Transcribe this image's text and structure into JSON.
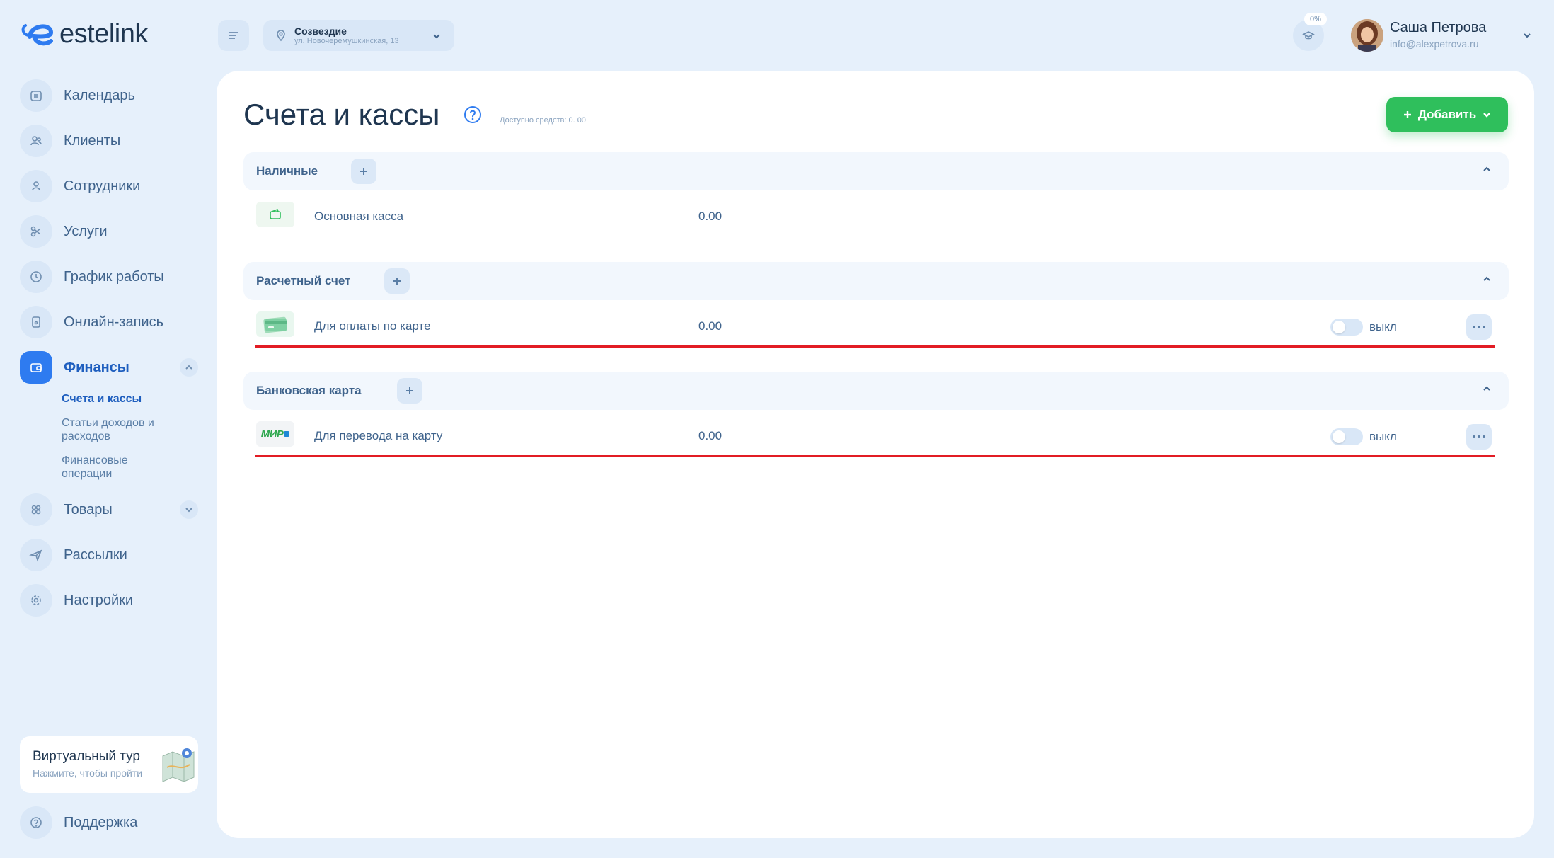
{
  "brand": {
    "name": "estelink"
  },
  "sidebar": {
    "items": [
      {
        "id": "calendar",
        "label": "Календарь",
        "icon": "calendar-icon"
      },
      {
        "id": "clients",
        "label": "Клиенты",
        "icon": "clients-icon"
      },
      {
        "id": "staff",
        "label": "Сотрудники",
        "icon": "user-icon"
      },
      {
        "id": "services",
        "label": "Услуги",
        "icon": "scissors-icon"
      },
      {
        "id": "schedule",
        "label": "График работы",
        "icon": "clock-icon"
      },
      {
        "id": "online",
        "label": "Онлайн-запись",
        "icon": "phone-icon"
      },
      {
        "id": "finance",
        "label": "Финансы",
        "icon": "wallet-icon",
        "active": true
      },
      {
        "id": "goods",
        "label": "Товары",
        "icon": "goods-icon"
      },
      {
        "id": "mailing",
        "label": "Рассылки",
        "icon": "send-icon"
      },
      {
        "id": "settings",
        "label": "Настройки",
        "icon": "gear-icon"
      }
    ],
    "finance_sub": [
      {
        "label": "Счета и кассы",
        "active": true
      },
      {
        "label": "Статьи доходов и расходов"
      },
      {
        "label": "Финансовые операции"
      }
    ],
    "tour": {
      "title": "Виртуальный тур",
      "subtitle": "Нажмите, чтобы пройти"
    },
    "support": {
      "label": "Поддержка"
    }
  },
  "topbar": {
    "location": {
      "name": "Созвездие",
      "address": "ул. Новочеремушкинская, 13"
    },
    "notif_badge": "0%",
    "user": {
      "name": "Саша Петрова",
      "email": "info@alexpetrova.ru"
    }
  },
  "page": {
    "title": "Счета и кассы",
    "available": "Доступно средств: 0. 00",
    "add_label": "Добавить"
  },
  "sections": [
    {
      "title": "Наличные",
      "rows": [
        {
          "name": "Основная касса",
          "amount": "0.00",
          "icon": "wallet-icon"
        }
      ]
    },
    {
      "title": "Расчетный счет",
      "rows": [
        {
          "name": "Для оплаты по карте",
          "amount": "0.00",
          "icon": "card-icon",
          "toggle_label": "выкл"
        }
      ]
    },
    {
      "title": "Банковская карта",
      "rows": [
        {
          "name": "Для перевода на карту",
          "amount": "0.00",
          "icon": "mir-logo",
          "logo_text": "МИР",
          "toggle_label": "выкл"
        }
      ]
    }
  ],
  "colors": {
    "accent": "#2e7bf0",
    "add_button": "#2fbf5c",
    "highlight_line": "#e21c24",
    "background": "#e6f0fb"
  }
}
